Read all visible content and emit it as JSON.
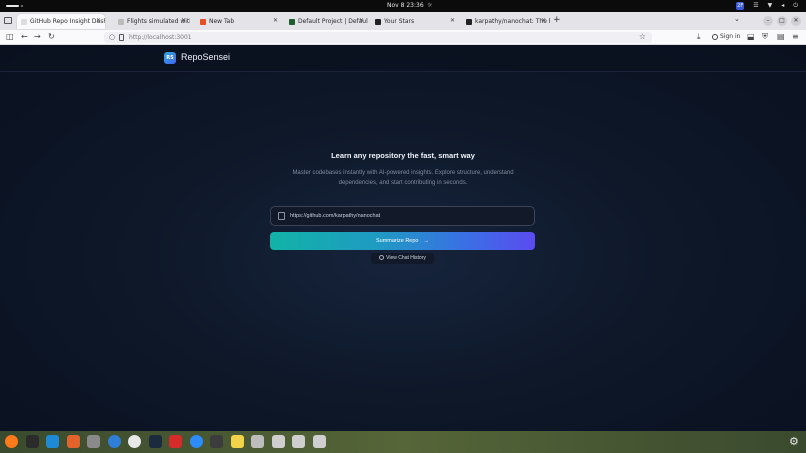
{
  "system": {
    "clock": "Nov 8  23:36",
    "tray_badge": "2F"
  },
  "browser": {
    "tabs": [
      {
        "label": "GitHub Repo Insight Dashbo",
        "active": true,
        "favicon_color": "#dddddd"
      },
      {
        "label": "Flights simulated with Re",
        "active": false,
        "favicon_color": "#bbbbbb"
      },
      {
        "label": "New Tab",
        "active": false,
        "favicon_color": "#e44d26"
      },
      {
        "label": "Default Project | Default",
        "active": false,
        "favicon_color": "#1f5e2f"
      },
      {
        "label": "Your Stars",
        "active": false,
        "favicon_color": "#222222"
      },
      {
        "label": "karpathy/nanochat: The b",
        "active": false,
        "favicon_color": "#222222"
      }
    ],
    "new_tab_icon": "+",
    "url": "http://localhost:3001",
    "sign_in_label": "Sign in"
  },
  "app": {
    "logo_text": "RS",
    "brand": "RepoSensei",
    "hero_title": "Learn any repository the fast, smart way",
    "hero_subtitle": "Master codebases instantly with AI-powered insights. Explore structure, understand dependencies, and start contributing in seconds.",
    "repo_input_value": "https://github.com/karpathy/nanochat",
    "summarize_label": "Summarize Repo",
    "history_label": "View Chat History"
  },
  "dock": {
    "apps": [
      {
        "name": "firefox-icon",
        "color": "#ff7a1a",
        "round": true
      },
      {
        "name": "terminal-icon",
        "color": "#2b2b2b",
        "round": false
      },
      {
        "name": "vscode-icon",
        "color": "#1e8ad6",
        "round": false
      },
      {
        "name": "software-center-icon",
        "color": "#e2642a",
        "round": false
      },
      {
        "name": "files-icon",
        "color": "#8a8a8a",
        "round": false
      },
      {
        "name": "help-icon",
        "color": "#2f7fd8",
        "round": true
      },
      {
        "name": "chatgpt-icon",
        "color": "#e8e8e8",
        "round": true
      },
      {
        "name": "steam-icon",
        "color": "#1b2a3c",
        "round": false
      },
      {
        "name": "zotero-icon",
        "color": "#d62b2b",
        "round": false
      },
      {
        "name": "zoom-icon",
        "color": "#2d8cff",
        "round": true
      },
      {
        "name": "monitor-icon",
        "color": "#3c3c3c",
        "round": false
      },
      {
        "name": "notes-icon",
        "color": "#f2d44a",
        "round": false
      },
      {
        "name": "drive-icon",
        "color": "#bdbdbd",
        "round": false
      },
      {
        "name": "document-icon",
        "color": "#cfcfcf",
        "round": false
      },
      {
        "name": "document-icon-2",
        "color": "#cfcfcf",
        "round": false
      },
      {
        "name": "document-icon-3",
        "color": "#cfcfcf",
        "round": false
      }
    ]
  }
}
